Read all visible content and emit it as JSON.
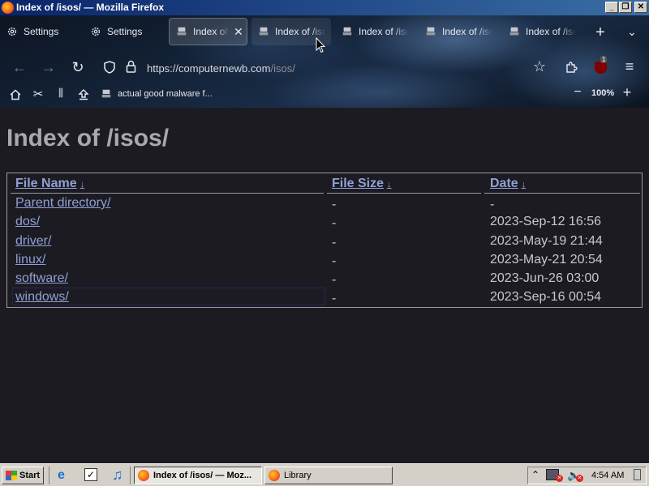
{
  "window": {
    "title": "Index of /isos/ — Mozilla Firefox",
    "controls": [
      "_",
      "❐",
      "✕"
    ]
  },
  "tabs": [
    {
      "label": "Settings",
      "icon": "gear-icon"
    },
    {
      "label": "Settings",
      "icon": "gear-icon"
    },
    {
      "label": "Index of /isos/",
      "icon": "server-icon",
      "active": true
    },
    {
      "label": "Index of /isos/",
      "icon": "server-icon"
    },
    {
      "label": "Index of /isos/",
      "icon": "server-icon"
    },
    {
      "label": "Index of /isos/",
      "icon": "server-icon"
    },
    {
      "label": "Index of /isos/",
      "icon": "server-icon"
    }
  ],
  "navbar": {
    "url_host": "https://computernewb.com",
    "url_path": "/isos/",
    "extension_badge": "1"
  },
  "bookmarks": {
    "item": "actual good malware f...",
    "zoom": "100%"
  },
  "page": {
    "heading": "Index of /isos/",
    "columns": [
      "File Name",
      "File Size",
      "Date"
    ],
    "sort_arrow": "↓",
    "rows": [
      {
        "name": "Parent directory/",
        "size": "-",
        "date": "-"
      },
      {
        "name": "dos/",
        "size": "-",
        "date": "2023-Sep-12 16:56"
      },
      {
        "name": "driver/",
        "size": "-",
        "date": "2023-May-19 21:44"
      },
      {
        "name": "linux/",
        "size": "-",
        "date": "2023-May-21 20:54"
      },
      {
        "name": "software/",
        "size": "-",
        "date": "2023-Jun-26 03:00"
      },
      {
        "name": "windows/",
        "size": "-",
        "date": "2023-Sep-16 00:54"
      }
    ]
  },
  "taskbar": {
    "start": "Start",
    "tasks": [
      "Index of /isos/ — Moz...",
      "Library"
    ],
    "clock": "4:54 AM"
  }
}
